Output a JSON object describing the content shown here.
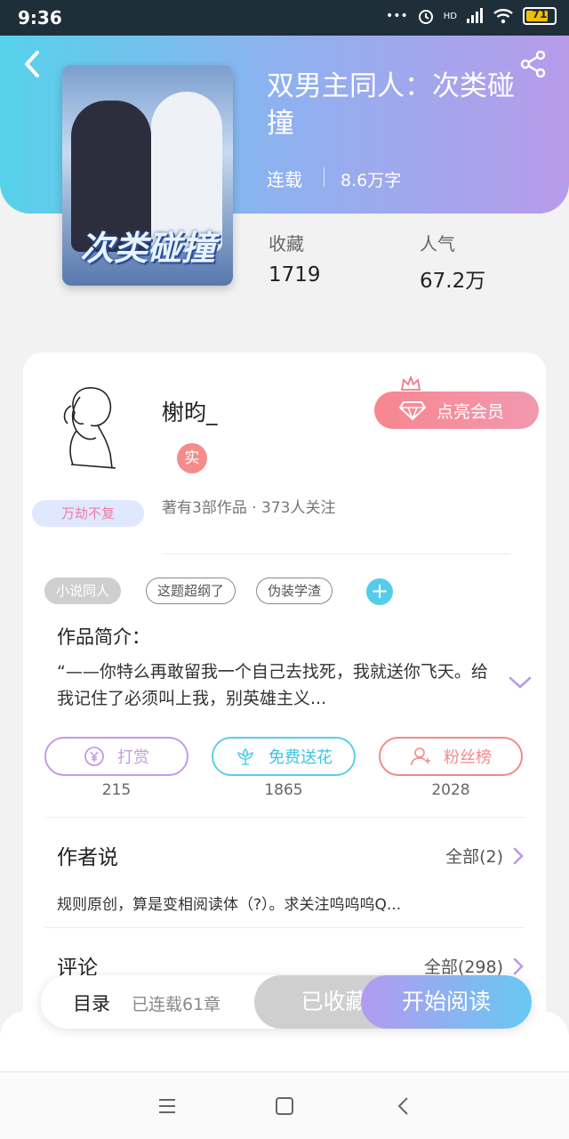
{
  "status": {
    "time": "9:36",
    "signal_label": "HD",
    "battery": "71"
  },
  "book": {
    "title": "双男主同人：次类碰撞",
    "status": "连载",
    "words": "8.6万字",
    "cover_title": "次类碰撞",
    "stats": [
      {
        "label": "收藏",
        "value": "1719"
      },
      {
        "label": "人气",
        "value": "67.2万"
      }
    ]
  },
  "author": {
    "name": "榭昀_",
    "real_badge": "实",
    "vip_label": "点亮会员",
    "tag": "万劫不复",
    "meta": "著有3部作品 · 373人关注"
  },
  "tags": [
    "小说同人",
    "这题超纲了",
    "伪装学渣"
  ],
  "intro": {
    "title": "作品简介：",
    "text": "“——你特么再敢留我一个自己去找死，我就送你飞天。给我记住了必须叫上我，别英雄主义..."
  },
  "actions": [
    {
      "label": "打赏",
      "count": "215",
      "color": "#c69ae6"
    },
    {
      "label": "免费送花",
      "count": "1865",
      "color": "#5bcfe8"
    },
    {
      "label": "粉丝榜",
      "count": "2028",
      "color": "#f28a8a"
    }
  ],
  "author_say": {
    "title": "作者说",
    "more": "全部(2)",
    "text": "规则原创，算是变相阅读体（?）。求关注呜呜呜Q..."
  },
  "comments": {
    "title": "评论",
    "more": "全部(298)"
  },
  "bottom": {
    "catalog": "目录",
    "chapters": "已连载61章",
    "collected": "已收藏",
    "read": "开始阅读"
  }
}
